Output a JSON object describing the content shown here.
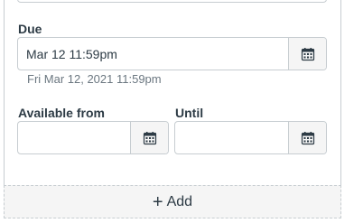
{
  "due": {
    "label": "Due",
    "value": "Mar 12 11:59pm",
    "hint": "Fri Mar 12, 2021 11:59pm"
  },
  "available_from": {
    "label": "Available from",
    "value": ""
  },
  "until": {
    "label": "Until",
    "value": ""
  },
  "add_button": {
    "icon": "plus-icon",
    "label": "Add"
  },
  "colors": {
    "text": "#2d3b45",
    "border": "#c7cdd1",
    "button_bg": "#f5f5f5",
    "hint": "#6b7780"
  }
}
